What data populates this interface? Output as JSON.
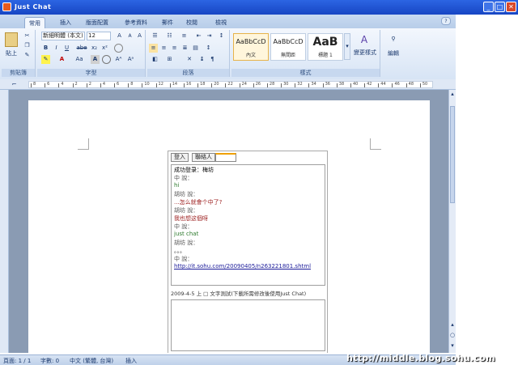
{
  "window": {
    "title": "Just Chat",
    "minimize": "_",
    "maximize": "□",
    "close": "✕"
  },
  "ribbon": {
    "tabs": [
      "常用",
      "插入",
      "版面配置",
      "參考資料",
      "郵件",
      "校閱",
      "檢視"
    ],
    "active_tab": "常用",
    "clipboard": {
      "paste_label": "貼上",
      "group_label": "剪貼簿"
    },
    "font": {
      "name": "新細明體 (本文)",
      "size": "12",
      "group_label": "字型",
      "bold": "B",
      "italic": "I",
      "underline": "U",
      "strike": "abe",
      "sub": "x₂",
      "sup": "x²",
      "grow": "A",
      "shrink": "A",
      "case": "Aa",
      "clear": "A"
    },
    "paragraph": {
      "group_label": "段落"
    },
    "styles": {
      "group_label": "樣式",
      "items": [
        {
          "sample": "AaBbCcD",
          "name": "內文"
        },
        {
          "sample": "AaBbCcD",
          "name": "無間距"
        },
        {
          "sample": "AaB",
          "name": "標題 1"
        }
      ],
      "change_label": "變更樣式"
    },
    "editing": {
      "label": "編輯"
    }
  },
  "ruler": {
    "marks": [
      "8",
      "6",
      "4",
      "2",
      "2",
      "4",
      "6",
      "8",
      "10",
      "12",
      "14",
      "16",
      "18",
      "20",
      "22",
      "24",
      "26",
      "28",
      "30",
      "32",
      "34",
      "36",
      "38",
      "40",
      "42",
      "44",
      "46",
      "48",
      "50"
    ]
  },
  "chat": {
    "tabs": [
      "登入",
      "聯絡人",
      ""
    ],
    "messages": [
      {
        "text": "成功登录：梅坊",
        "color": "#000000"
      },
      {
        "text": "中 說：",
        "color": "#555555"
      },
      {
        "text": "hi",
        "color": "#2d7a2d"
      },
      {
        "text": "胡坊 說：",
        "color": "#555555"
      },
      {
        "text": "...怎么就會个中了?",
        "color": "#9b1c1c"
      },
      {
        "text": "胡坊 說：",
        "color": "#555555"
      },
      {
        "text": "我也想这個呀",
        "color": "#9b1c1c"
      },
      {
        "text": "中 說：",
        "color": "#555555"
      },
      {
        "text": "just chat",
        "color": "#2d7a2d"
      },
      {
        "text": "胡坊 說：",
        "color": "#555555"
      },
      {
        "text": "。。。",
        "color": "#333333"
      },
      {
        "text": "中 說：",
        "color": "#555555"
      },
      {
        "text": "http://it.sohu.com/20090405/n263221801.shtml",
        "color": "#1a1a99"
      }
    ],
    "option_text": "2009-4-5 上 □ 文字測試(下載所需修改後使用Just Chat)"
  },
  "status": {
    "page": "頁面: 1 / 1",
    "words": "字數: 0",
    "language": "中文 (繁體, 台灣)",
    "mode": "插入"
  },
  "watermark": "http://middle.blog.sohu.com"
}
